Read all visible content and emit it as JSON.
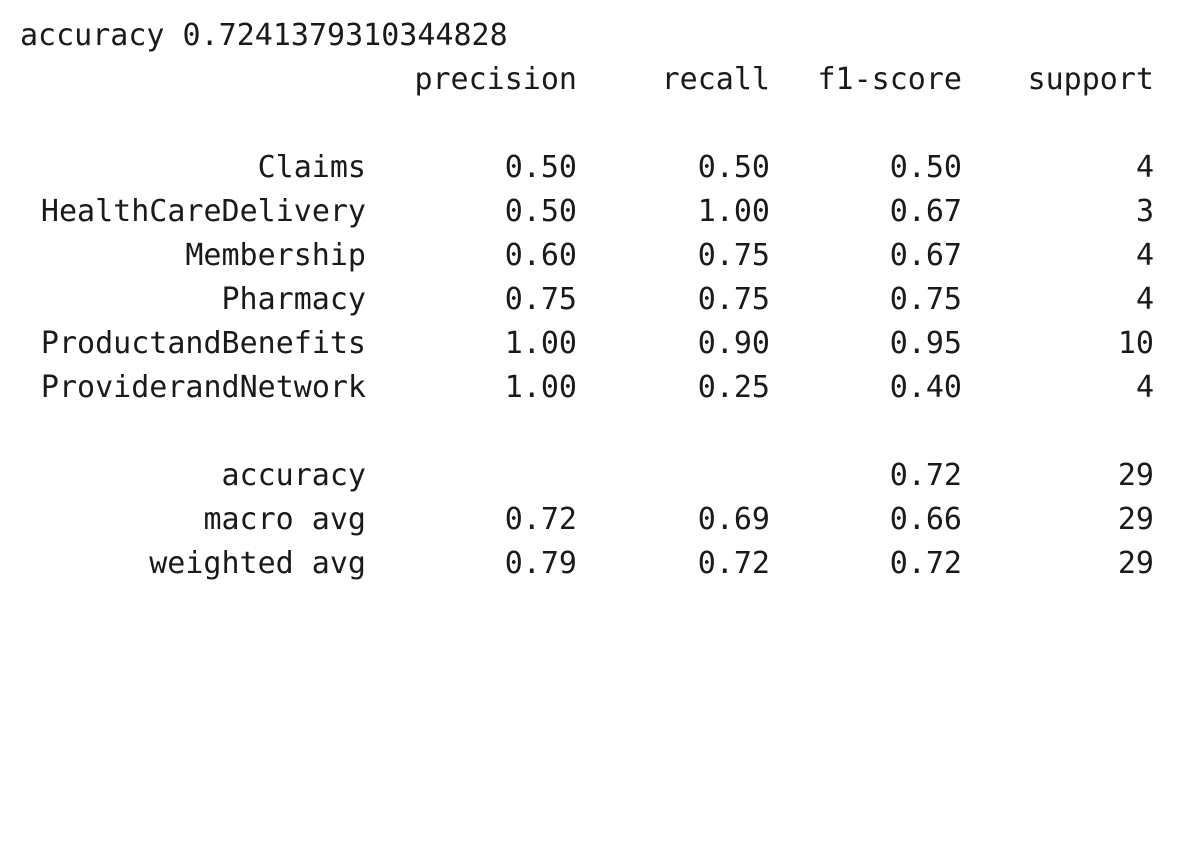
{
  "accuracy_line": "accuracy 0.7241379310344828",
  "headers": {
    "precision": "precision",
    "recall": "recall",
    "f1": "f1-score",
    "support": "support"
  },
  "classes": [
    {
      "label": "Claims",
      "precision": "0.50",
      "recall": "0.50",
      "f1": "0.50",
      "support": "4"
    },
    {
      "label": "HealthCareDelivery",
      "precision": "0.50",
      "recall": "1.00",
      "f1": "0.67",
      "support": "3"
    },
    {
      "label": "Membership",
      "precision": "0.60",
      "recall": "0.75",
      "f1": "0.67",
      "support": "4"
    },
    {
      "label": "Pharmacy",
      "precision": "0.75",
      "recall": "0.75",
      "f1": "0.75",
      "support": "4"
    },
    {
      "label": "ProductandBenefits",
      "precision": "1.00",
      "recall": "0.90",
      "f1": "0.95",
      "support": "10"
    },
    {
      "label": "ProviderandNetwork",
      "precision": "1.00",
      "recall": "0.25",
      "f1": "0.40",
      "support": "4"
    }
  ],
  "summary": [
    {
      "label": "accuracy",
      "precision": "",
      "recall": "",
      "f1": "0.72",
      "support": "29"
    },
    {
      "label": "macro avg",
      "precision": "0.72",
      "recall": "0.69",
      "f1": "0.66",
      "support": "29"
    },
    {
      "label": "weighted avg",
      "precision": "0.79",
      "recall": "0.72",
      "f1": "0.72",
      "support": "29"
    }
  ]
}
